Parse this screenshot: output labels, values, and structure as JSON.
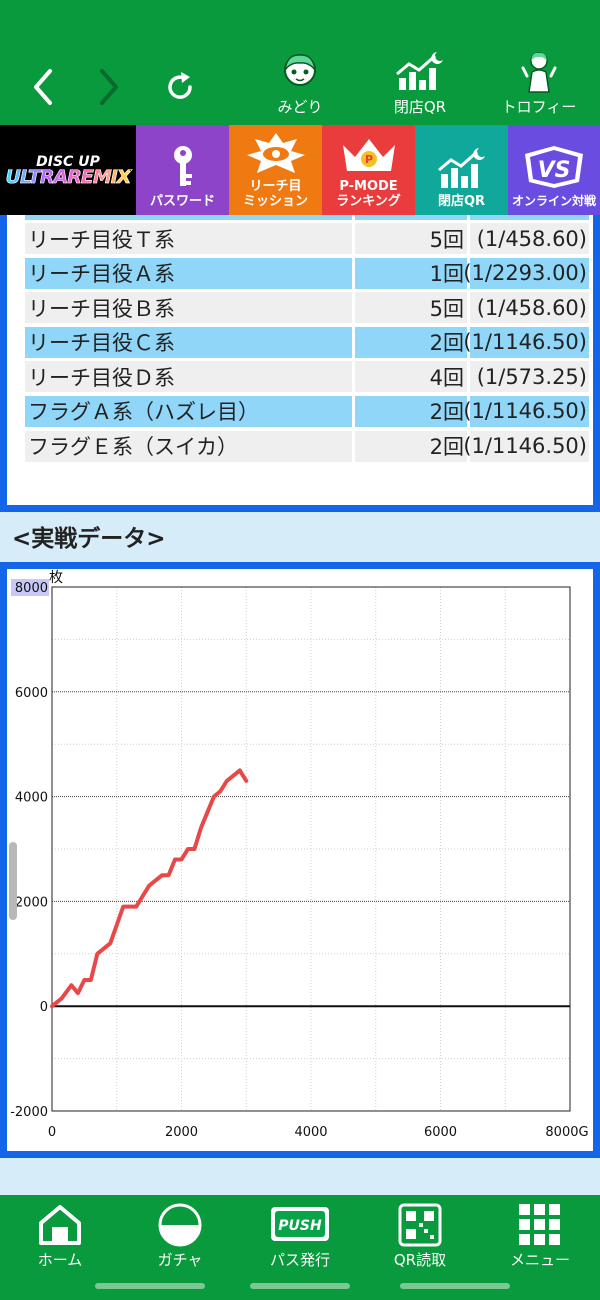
{
  "top_nav": {
    "back": "back",
    "forward": "forward",
    "reload": "reload",
    "items": [
      {
        "label": "みどり",
        "icon": "character-icon"
      },
      {
        "label": "閉店QR",
        "icon": "closing-qr-icon"
      },
      {
        "label": "トロフィー",
        "icon": "trophy-icon"
      }
    ]
  },
  "tiles": {
    "logo_top": "DISC UP",
    "logo_bottom": "ULTRAREMIX",
    "items": [
      {
        "label": "パスワード",
        "color": "#8e44c8"
      },
      {
        "label": "リーチ目\nミッション",
        "color": "#f07a12"
      },
      {
        "label": "P-MODE\nランキング",
        "color": "#ea3c3c"
      },
      {
        "label": "閉店QR",
        "color": "#10a89a"
      },
      {
        "label": "オンライン対戦",
        "color": "#6a4ce0"
      }
    ]
  },
  "stats": {
    "rows": [
      {
        "name": "リーチ目役Ｔ系",
        "count": "5回",
        "prob": "(1/458.60)"
      },
      {
        "name": "リーチ目役Ａ系",
        "count": "1回",
        "prob": "(1/2293.00)"
      },
      {
        "name": "リーチ目役Ｂ系",
        "count": "5回",
        "prob": "(1/458.60)"
      },
      {
        "name": "リーチ目役Ｃ系",
        "count": "2回",
        "prob": "(1/1146.50)"
      },
      {
        "name": "リーチ目役Ｄ系",
        "count": "4回",
        "prob": "(1/573.25)"
      },
      {
        "name": "フラグＡ系（ハズレ目）",
        "count": "2回",
        "prob": "(1/1146.50)"
      },
      {
        "name": "フラグＥ系（スイカ）",
        "count": "2回",
        "prob": "(1/1146.50)"
      }
    ]
  },
  "section": {
    "title": "<実戦データ>"
  },
  "chart_data": {
    "type": "line",
    "ylabel": "枚",
    "xlim": [
      0,
      8000
    ],
    "ylim": [
      -2000,
      8000
    ],
    "x_ticks": [
      "0",
      "2000",
      "4000",
      "6000",
      "8000G"
    ],
    "y_ticks": [
      "8000",
      "6000",
      "4000",
      "2000",
      "0",
      "-2000"
    ],
    "grid": true,
    "series": [
      {
        "color": "#e84848",
        "x": [
          0,
          150,
          300,
          400,
          500,
          600,
          700,
          800,
          900,
          1000,
          1100,
          1200,
          1300,
          1400,
          1500,
          1600,
          1700,
          1800,
          1900,
          2000,
          2100,
          2200,
          2300,
          2400,
          2500,
          2600,
          2700,
          2800,
          2900,
          3000
        ],
        "y": [
          0,
          150,
          400,
          250,
          500,
          500,
          1000,
          1100,
          1200,
          1550,
          1900,
          1900,
          1900,
          2100,
          2300,
          2400,
          2500,
          2500,
          2800,
          2800,
          3000,
          3000,
          3400,
          3700,
          4000,
          4100,
          4300,
          4400,
          4500,
          4300
        ]
      }
    ]
  },
  "bottom_nav": {
    "items": [
      {
        "label": "ホーム",
        "icon": "home-icon"
      },
      {
        "label": "ガチャ",
        "icon": "gacha-icon"
      },
      {
        "label": "パス発行",
        "icon": "push-icon",
        "badge": "PUSH"
      },
      {
        "label": "QR読取",
        "icon": "qr-icon"
      },
      {
        "label": "メニュー",
        "icon": "menu-grid-icon"
      }
    ]
  }
}
